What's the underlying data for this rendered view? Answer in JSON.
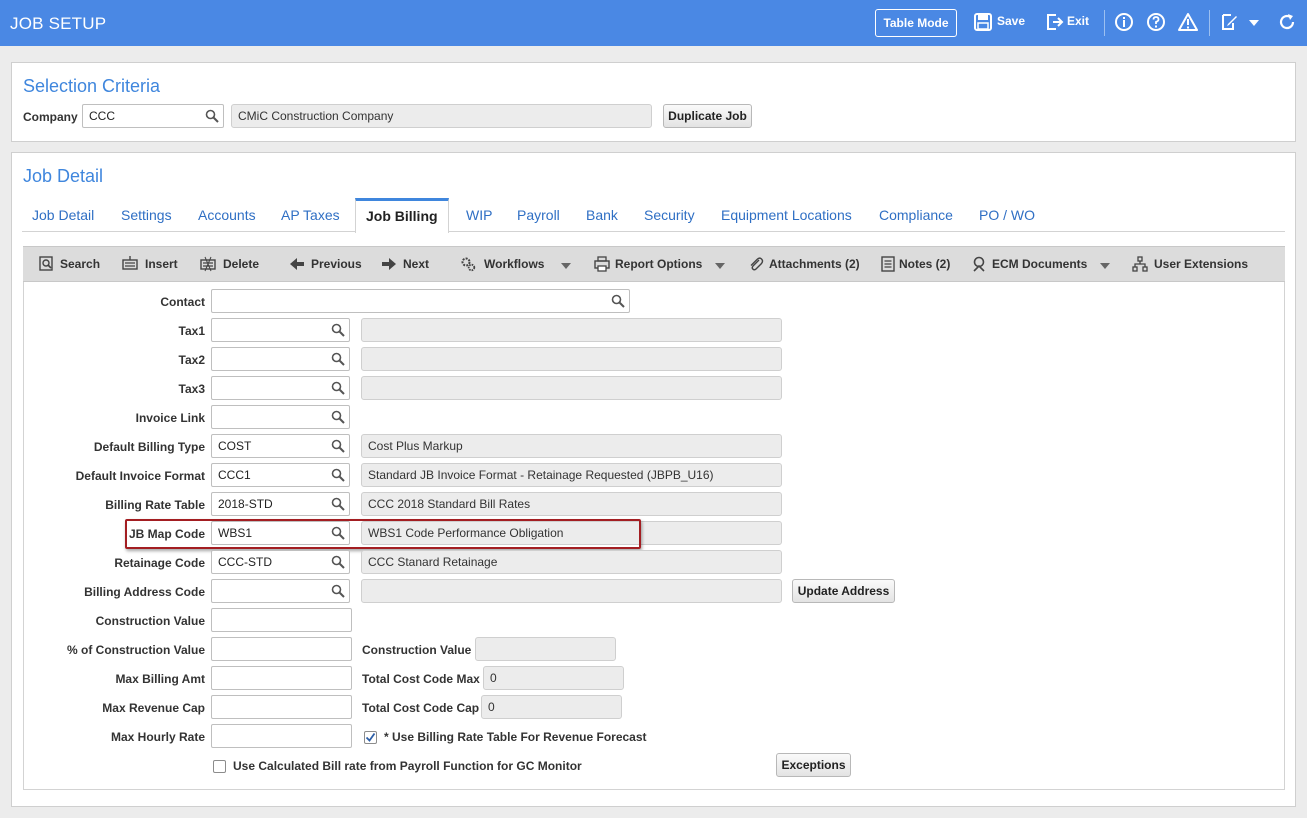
{
  "app": {
    "title": "JOB SETUP",
    "table_mode_label": "Table Mode",
    "save_label": "Save",
    "exit_label": "Exit"
  },
  "selection": {
    "title": "Selection Criteria",
    "company_label": "Company",
    "company_value": "CCC",
    "company_name": "CMiC Construction Company",
    "duplicate_label": "Duplicate Job"
  },
  "detail": {
    "title": "Job Detail",
    "tabs": [
      "Job Detail",
      "Settings",
      "Accounts",
      "AP Taxes",
      "Job Billing",
      "WIP",
      "Payroll",
      "Bank",
      "Security",
      "Equipment Locations",
      "Compliance",
      "PO / WO"
    ],
    "active_tab": "Job Billing"
  },
  "toolbar": {
    "search": "Search",
    "insert": "Insert",
    "delete": "Delete",
    "previous": "Previous",
    "next": "Next",
    "workflows": "Workflows",
    "report_options": "Report Options",
    "attachments": "Attachments (2)",
    "notes": "Notes (2)",
    "ecm": "ECM Documents",
    "user_ext": "User Extensions"
  },
  "form": {
    "contact": {
      "label": "Contact",
      "value": ""
    },
    "tax1": {
      "label": "Tax1",
      "value": "",
      "desc": ""
    },
    "tax2": {
      "label": "Tax2",
      "value": "",
      "desc": ""
    },
    "tax3": {
      "label": "Tax3",
      "value": "",
      "desc": ""
    },
    "invoice_link": {
      "label": "Invoice Link",
      "value": ""
    },
    "billing_type": {
      "label": "Default Billing Type",
      "value": "COST",
      "desc": "Cost Plus Markup"
    },
    "invoice_format": {
      "label": "Default Invoice Format",
      "value": "CCC1",
      "desc": "Standard JB Invoice Format - Retainage Requested (JBPB_U16)"
    },
    "rate_table": {
      "label": "Billing Rate Table",
      "value": "2018-STD",
      "desc": "CCC 2018 Standard Bill Rates"
    },
    "jb_map": {
      "label": "JB Map Code",
      "value": "WBS1",
      "desc": "WBS1 Code Performance Obligation"
    },
    "retainage": {
      "label": "Retainage Code",
      "value": "CCC-STD",
      "desc": "CCC Stanard Retainage"
    },
    "billing_address": {
      "label": "Billing Address Code",
      "value": "",
      "desc": "",
      "button": "Update Address"
    },
    "construction_value": {
      "label": "Construction Value",
      "value": ""
    },
    "pct_construction": {
      "label": "% of Construction Value",
      "value": "",
      "ro_label": "Construction Value",
      "ro_value": ""
    },
    "max_billing": {
      "label": "Max Billing Amt",
      "value": "",
      "ro_label": "Total Cost Code Max",
      "ro_value": "0"
    },
    "max_revenue": {
      "label": "Max Revenue Cap",
      "value": "",
      "ro_label": "Total Cost Code Cap",
      "ro_value": "0"
    },
    "max_hourly": {
      "label": "Max Hourly Rate",
      "value": "",
      "check_label": "* Use Billing Rate Table For Revenue Forecast",
      "checked": true
    },
    "calc_bill": {
      "label": "Use Calculated Bill rate from Payroll Function for GC Monitor",
      "checked": false
    },
    "exceptions_label": "Exceptions"
  },
  "colors": {
    "header": "#4a88e4",
    "accent": "#3f86dd",
    "highlight": "#a31e22"
  }
}
